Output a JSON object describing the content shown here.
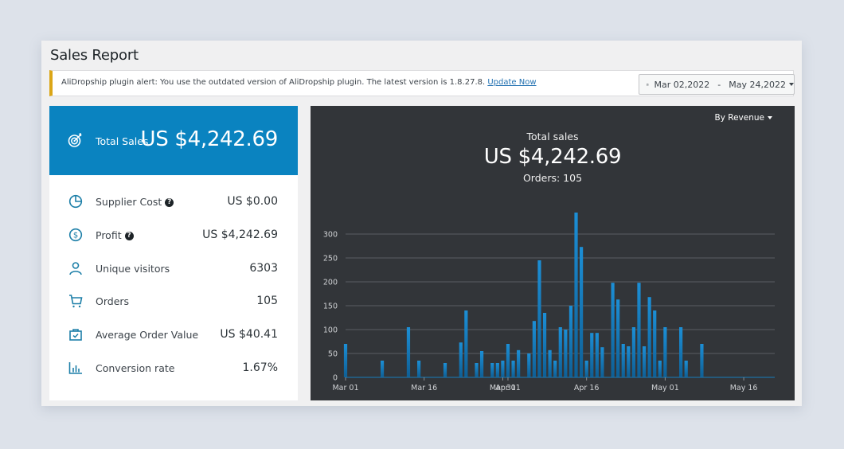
{
  "page": {
    "title": "Sales Report"
  },
  "notice": {
    "text": "AliDropship plugin alert: You use the outdated version of AliDropship plugin. The latest version is 1.8.27.8. ",
    "link_label": "Update Now"
  },
  "date_range": {
    "icon": "calendar-icon",
    "start": "Mar 02,2022",
    "separator": "-",
    "end": "May 24,2022"
  },
  "summary": {
    "total_sales": {
      "icon": "target-icon",
      "label": "Total Sales",
      "value": "US $4,242.69"
    },
    "metrics": [
      {
        "icon": "pie-chart-icon",
        "label": "Supplier Cost",
        "help": true,
        "value": "US $0.00"
      },
      {
        "icon": "dollar-circle-icon",
        "label": "Profit",
        "help": true,
        "value": "US $4,242.69"
      },
      {
        "icon": "user-icon",
        "label": "Unique visitors",
        "help": false,
        "value": "6303"
      },
      {
        "icon": "cart-icon",
        "label": "Orders",
        "help": false,
        "value": "105"
      },
      {
        "icon": "shopping-bag-icon",
        "label": "Average Order Value",
        "help": false,
        "value": "US $40.41"
      },
      {
        "icon": "bar-chart-icon",
        "label": "Conversion rate",
        "help": false,
        "value": "1.67%"
      }
    ],
    "help_glyph": "?"
  },
  "chart_panel": {
    "metric_select": "By Revenue",
    "title": "Total sales",
    "value": "US $4,242.69",
    "orders": "Orders: 105"
  },
  "colors": {
    "accent": "#0a83c0",
    "chart_bg": "#323539",
    "bar": "#1a86c8",
    "notice_border": "#dba617"
  },
  "chart_data": {
    "type": "bar",
    "title": "Total sales",
    "xlabel": "",
    "ylabel": "",
    "ylim": [
      0,
      300
    ],
    "yticks": [
      0,
      50,
      100,
      150,
      200,
      250,
      300
    ],
    "grid": true,
    "x_range_days": [
      0,
      82
    ],
    "xtick_labels": [
      {
        "day": 0,
        "label": "Mar 01"
      },
      {
        "day": 15,
        "label": "Mar 16"
      },
      {
        "day": 30,
        "label": "Mar 31"
      },
      {
        "day": 31,
        "label": "Apr 01"
      },
      {
        "day": 46,
        "label": "Apr 16"
      },
      {
        "day": 61,
        "label": "May 01"
      },
      {
        "day": 76,
        "label": "May 16"
      }
    ],
    "x_unit": "days since Mar 01, 2022",
    "series": [
      {
        "name": "Revenue",
        "points": [
          {
            "day": 0,
            "value": 70
          },
          {
            "day": 7,
            "value": 35
          },
          {
            "day": 12,
            "value": 105
          },
          {
            "day": 14,
            "value": 35
          },
          {
            "day": 19,
            "value": 30
          },
          {
            "day": 22,
            "value": 73
          },
          {
            "day": 23,
            "value": 140
          },
          {
            "day": 25,
            "value": 30
          },
          {
            "day": 26,
            "value": 55
          },
          {
            "day": 28,
            "value": 30
          },
          {
            "day": 29,
            "value": 30
          },
          {
            "day": 30,
            "value": 35
          },
          {
            "day": 31,
            "value": 70
          },
          {
            "day": 32,
            "value": 35
          },
          {
            "day": 33,
            "value": 57
          },
          {
            "day": 35,
            "value": 50
          },
          {
            "day": 36,
            "value": 118
          },
          {
            "day": 37,
            "value": 245
          },
          {
            "day": 38,
            "value": 135
          },
          {
            "day": 39,
            "value": 57
          },
          {
            "day": 40,
            "value": 35
          },
          {
            "day": 41,
            "value": 105
          },
          {
            "day": 42,
            "value": 100
          },
          {
            "day": 43,
            "value": 150
          },
          {
            "day": 44,
            "value": 345
          },
          {
            "day": 45,
            "value": 273
          },
          {
            "day": 46,
            "value": 35
          },
          {
            "day": 47,
            "value": 93
          },
          {
            "day": 48,
            "value": 93
          },
          {
            "day": 49,
            "value": 63
          },
          {
            "day": 51,
            "value": 198
          },
          {
            "day": 52,
            "value": 163
          },
          {
            "day": 53,
            "value": 70
          },
          {
            "day": 54,
            "value": 65
          },
          {
            "day": 55,
            "value": 105
          },
          {
            "day": 56,
            "value": 198
          },
          {
            "day": 57,
            "value": 65
          },
          {
            "day": 58,
            "value": 168
          },
          {
            "day": 59,
            "value": 140
          },
          {
            "day": 60,
            "value": 35
          },
          {
            "day": 61,
            "value": 105
          },
          {
            "day": 64,
            "value": 105
          },
          {
            "day": 65,
            "value": 35
          },
          {
            "day": 68,
            "value": 70
          }
        ]
      }
    ]
  }
}
